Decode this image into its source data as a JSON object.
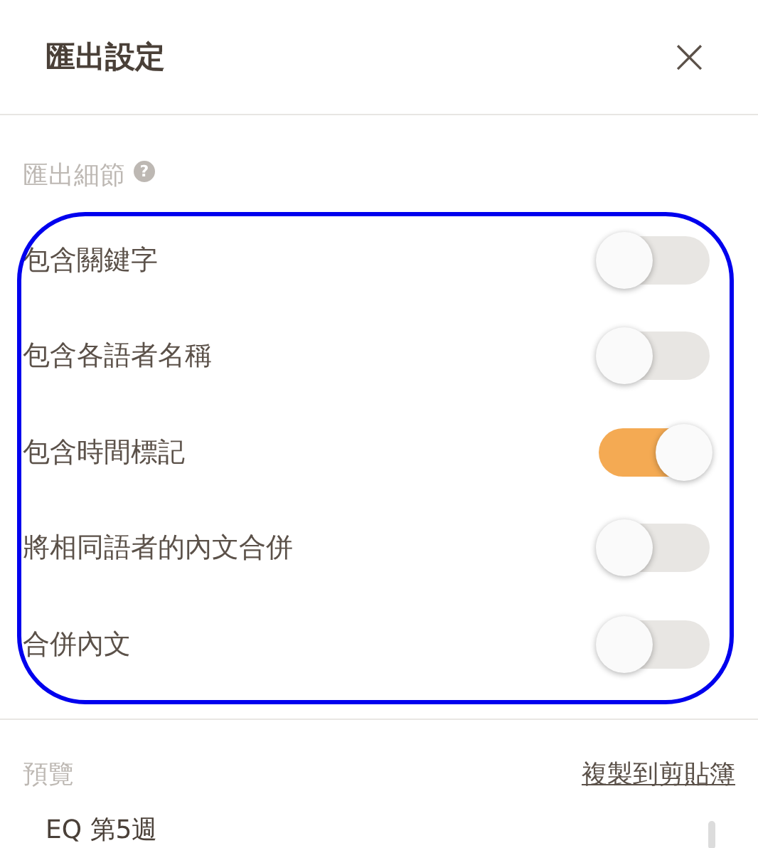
{
  "dialog": {
    "title": "匯出設定",
    "close": "×"
  },
  "details": {
    "label": "匯出細節",
    "help": "?"
  },
  "options": [
    {
      "label": "包含關鍵字",
      "on": false
    },
    {
      "label": "包含各語者名稱",
      "on": false
    },
    {
      "label": "包含時間標記",
      "on": true
    },
    {
      "label": "將相同語者的內文合併",
      "on": false
    },
    {
      "label": "合併內文",
      "on": false
    }
  ],
  "preview": {
    "label": "預覽",
    "copy": "複製到剪貼簿",
    "text": "EQ 第5週"
  }
}
